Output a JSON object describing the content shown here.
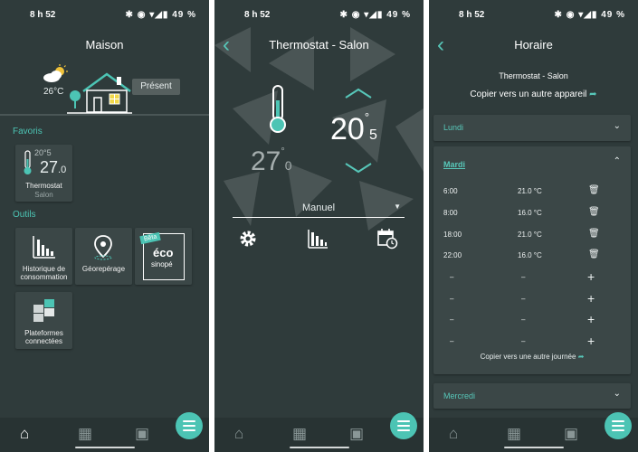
{
  "status": {
    "time": "8 h 52",
    "battery": "49 %",
    "icons": "✱ ◉ ▾◢▮"
  },
  "home": {
    "title": "Maison",
    "weather_temp": "26°C",
    "presence": "Présent",
    "favorites_label": "Favoris",
    "thermostat_set": "20",
    "thermostat_set_decimal": "5",
    "thermostat_current": "27",
    "thermostat_current_decimal": "0",
    "thermostat_name": "Thermostat",
    "thermostat_room": "Salon",
    "tools_label": "Outils",
    "tools": [
      {
        "label_line1": "Historique de",
        "label_line2": "consommation"
      },
      {
        "label_line1": "Géorepérage",
        "label_line2": ""
      },
      {
        "label_line1": "",
        "label_line2": "",
        "badge": "Bêta",
        "logo_top": "éco",
        "logo_bottom": "sinopé"
      },
      {
        "label_line1": "Plateformes",
        "label_line2": "connectées"
      }
    ]
  },
  "thermostat": {
    "title": "Thermostat - Salon",
    "setpoint": "20",
    "setpoint_decimal": "5",
    "current": "27",
    "current_decimal": "0",
    "degree": "°",
    "mode": "Manuel"
  },
  "schedule": {
    "title": "Horaire",
    "device": "Thermostat - Salon",
    "copy_device": "Copier vers un autre appareil",
    "day1": "Lundi",
    "day2": "Mardi",
    "day3": "Mercredi",
    "rows": [
      {
        "time": "6:00",
        "temp": "21.0 °C"
      },
      {
        "time": "8:00",
        "temp": "16.0 °C"
      },
      {
        "time": "18:00",
        "temp": "21.0 °C"
      },
      {
        "time": "22:00",
        "temp": "16.0 °C"
      }
    ],
    "empty_dash": "–",
    "copy_day": "Copier vers une autre journée"
  }
}
